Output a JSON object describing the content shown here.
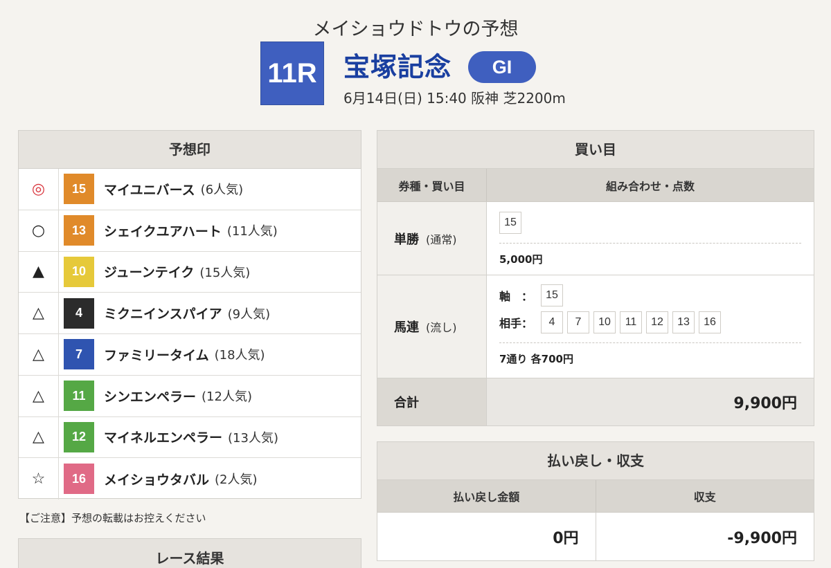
{
  "header": {
    "subtitle": "メイショウドトウの予想",
    "race_no": "11R",
    "race_name": "宝塚記念",
    "grade": "GI",
    "race_info": "6月14日(日) 15:40 阪神 芝2200m"
  },
  "prediction": {
    "title": "予想印",
    "rows": [
      {
        "mark": "◎",
        "mark_color": "#d9363e",
        "num": "15",
        "num_bg": "#e08a2a",
        "num_fg": "#ffffff",
        "name": "マイユニバース",
        "pop": "(6人気)"
      },
      {
        "mark": "○",
        "mark_color": "#222222",
        "num": "13",
        "num_bg": "#e08a2a",
        "num_fg": "#ffffff",
        "name": "シェイクユアハート",
        "pop": "(11人気)"
      },
      {
        "mark": "▲",
        "mark_color": "#222222",
        "num": "10",
        "num_bg": "#e6c93a",
        "num_fg": "#ffffff",
        "name": "ジューンテイク",
        "pop": "(15人気)"
      },
      {
        "mark": "△",
        "mark_color": "#222222",
        "num": "4",
        "num_bg": "#2b2b2b",
        "num_fg": "#ffffff",
        "name": "ミクニインスパイア",
        "pop": "(9人気)"
      },
      {
        "mark": "△",
        "mark_color": "#222222",
        "num": "7",
        "num_bg": "#2f54b0",
        "num_fg": "#ffffff",
        "name": "ファミリータイム",
        "pop": "(18人気)"
      },
      {
        "mark": "△",
        "mark_color": "#222222",
        "num": "11",
        "num_bg": "#55a845",
        "num_fg": "#ffffff",
        "name": "シンエンペラー",
        "pop": "(12人気)"
      },
      {
        "mark": "△",
        "mark_color": "#222222",
        "num": "12",
        "num_bg": "#55a845",
        "num_fg": "#ffffff",
        "name": "マイネルエンペラー",
        "pop": "(13人気)"
      },
      {
        "mark": "☆",
        "mark_color": "#222222",
        "num": "16",
        "num_bg": "#e06a86",
        "num_fg": "#ffffff",
        "name": "メイショウタバル",
        "pop": "(2人気)"
      }
    ]
  },
  "notice": "【ご注意】予想の転載はお控えください",
  "result": {
    "title": "レース結果"
  },
  "bets": {
    "title": "買い目",
    "col1": "券種・買い目",
    "col2": "組み合わせ・点数",
    "win": {
      "type": "単勝",
      "sub": "(通常)",
      "nums": [
        "15"
      ],
      "amount": "5,000円"
    },
    "quinella": {
      "type": "馬連",
      "sub": "(流し)",
      "axis_label": "軸　：",
      "axis": [
        "15"
      ],
      "partner_label": "相手：",
      "partners": [
        "4",
        "7",
        "10",
        "11",
        "12",
        "13",
        "16"
      ],
      "amount": "7通り 各700円"
    },
    "total_label": "合計",
    "total": "9,900円"
  },
  "payout": {
    "title": "払い戻し・収支",
    "col1": "払い戻し金額",
    "col2": "収支",
    "refund": "0円",
    "balance": "-9,900円"
  }
}
